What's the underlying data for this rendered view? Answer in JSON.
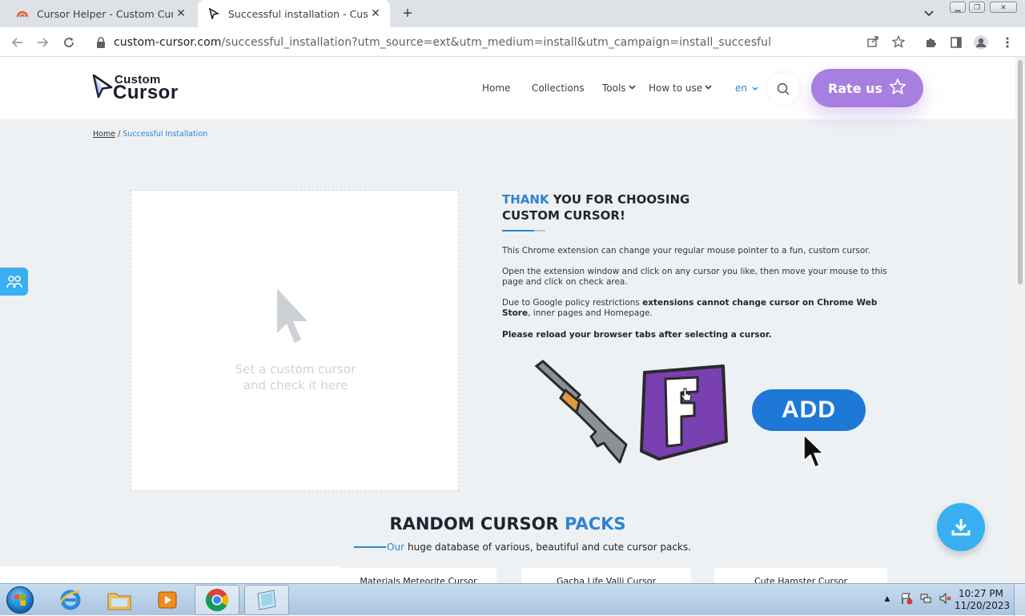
{
  "browser": {
    "tabs": [
      {
        "title": "Cursor Helper - Custom Cursor",
        "active": false
      },
      {
        "title": "Successful installation - Custom C",
        "active": true
      }
    ],
    "url_host": "custom-cursor.com",
    "url_path": "/successful_installation?utm_source=ext&utm_medium=install&utm_campaign=install_succesful"
  },
  "site": {
    "logo_top": "Custom",
    "logo_bottom": "Cursor",
    "nav": {
      "home": "Home",
      "collections": "Collections",
      "tools": "Tools",
      "how_to_use": "How to use",
      "lang": "en"
    },
    "rate_label": "Rate us",
    "breadcrumb": {
      "home": "Home",
      "separator": "/",
      "current": "Successful Installation"
    },
    "check_area": {
      "line1": "Set a custom cursor",
      "line2": "and check it here"
    },
    "thank": {
      "accent": "THANK",
      "rest1": " YOU FOR CHOOSING",
      "line2": "CUSTOM CURSOR!"
    },
    "para1": "This Chrome extension can change your regular mouse pointer to a fun, custom cursor.",
    "para2": "Open the extension window and click on any cursor you like, then move your mouse to this page and click on check area.",
    "para3_a": "Due to Google policy restrictions ",
    "para3_b": "extensions cannot change cursor on Chrome Web Store",
    "para3_c": ", inner pages and Homepage.",
    "para4": "Please reload your browser tabs after selecting a cursor.",
    "demo_letter": "F",
    "add_label": "ADD",
    "packs": {
      "title_a": "RANDOM CURSOR ",
      "title_b": "PACKS",
      "sub_our": "Our",
      "sub_rest": "huge database of various, beautiful and cute cursor packs.",
      "cards": [
        "Materials Meteorite Cursor",
        "Gacha Life Valli Cursor",
        "Cute Hamster Cursor"
      ]
    }
  },
  "taskbar": {
    "time": "10:27 PM",
    "date": "11/20/2023"
  },
  "colors": {
    "accent": "#2f83d0",
    "rate": "#a77fe0",
    "add": "#1e78d8",
    "fab": "#39aef0"
  }
}
